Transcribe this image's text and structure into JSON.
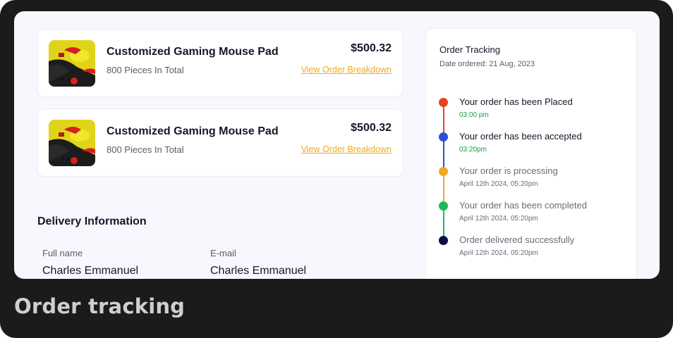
{
  "caption": "Order tracking",
  "products": [
    {
      "name": "Customized Gaming Mouse Pad",
      "quantity": "800 Pieces In Total",
      "price": "$500.32",
      "link": "View Order Breakdown"
    },
    {
      "name": "Customized Gaming Mouse Pad",
      "quantity": "800 Pieces In Total",
      "price": "$500.32",
      "link": "View Order Breakdown"
    }
  ],
  "delivery": {
    "title": "Delivery Information",
    "full_name_label": "Full name",
    "full_name_value": "Charles Emmanuel",
    "email_label": "E-mail",
    "email_value": "Charles Emmanuel"
  },
  "tracking": {
    "title": "Order Tracking",
    "date_ordered": "Date ordered: 21 Aug, 2023",
    "steps": [
      {
        "label": "Your order has been Placed",
        "time": "03:00 pm",
        "color": "#e8431f",
        "done": true
      },
      {
        "label": "Your order has been accepted",
        "time": "03:20pm",
        "color": "#2d4fd6",
        "done": true
      },
      {
        "label": "Your order is processing",
        "time": "April 12th 2024, 05:20pm",
        "color": "#f5a623",
        "done": false
      },
      {
        "label": "Your order has been completed",
        "time": "April 12th 2024, 05:20pm",
        "color": "#22b65a",
        "done": false
      },
      {
        "label": "Order delivered successfully",
        "time": "April 12th 2024, 05:20pm",
        "color": "#0d0d45",
        "done": false
      }
    ]
  },
  "colors": {
    "link": "#f2a91c",
    "done_time": "#1a9b3a",
    "pending_text": "#6b6b78",
    "active_text": "#16162a"
  }
}
